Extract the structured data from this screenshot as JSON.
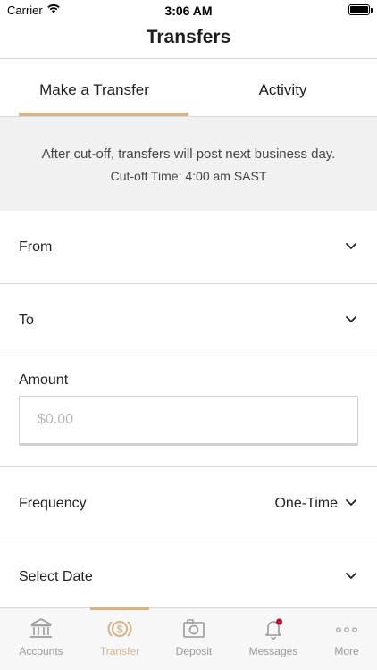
{
  "status_bar": {
    "carrier": "Carrier",
    "time": "3:06 AM"
  },
  "nav": {
    "title": "Transfers"
  },
  "tabs": {
    "make_transfer": "Make a Transfer",
    "activity": "Activity",
    "active": "make_transfer"
  },
  "notice": {
    "line1": "After cut-off, transfers will post next business day.",
    "line2": "Cut-off Time: 4:00 am SAST"
  },
  "form": {
    "from_label": "From",
    "to_label": "To",
    "amount_label": "Amount",
    "amount_placeholder": "$0.00",
    "amount_value": "",
    "frequency_label": "Frequency",
    "frequency_value": "One-Time",
    "date_label": "Select Date"
  },
  "tab_bar": {
    "items": [
      {
        "label": "Accounts",
        "icon": "bank-icon"
      },
      {
        "label": "Transfer",
        "icon": "transfer-dollar-icon"
      },
      {
        "label": "Deposit",
        "icon": "camera-icon"
      },
      {
        "label": "Messages",
        "icon": "bell-icon"
      },
      {
        "label": "More",
        "icon": "more-dots-icon"
      }
    ],
    "active_index": 1,
    "badge_color": "#c8102e"
  },
  "colors": {
    "accent": "#d4b48a",
    "notice_bg": "#f1f1f1",
    "divider": "#d8d8d8",
    "inactive_tab": "#9a9a9a"
  }
}
